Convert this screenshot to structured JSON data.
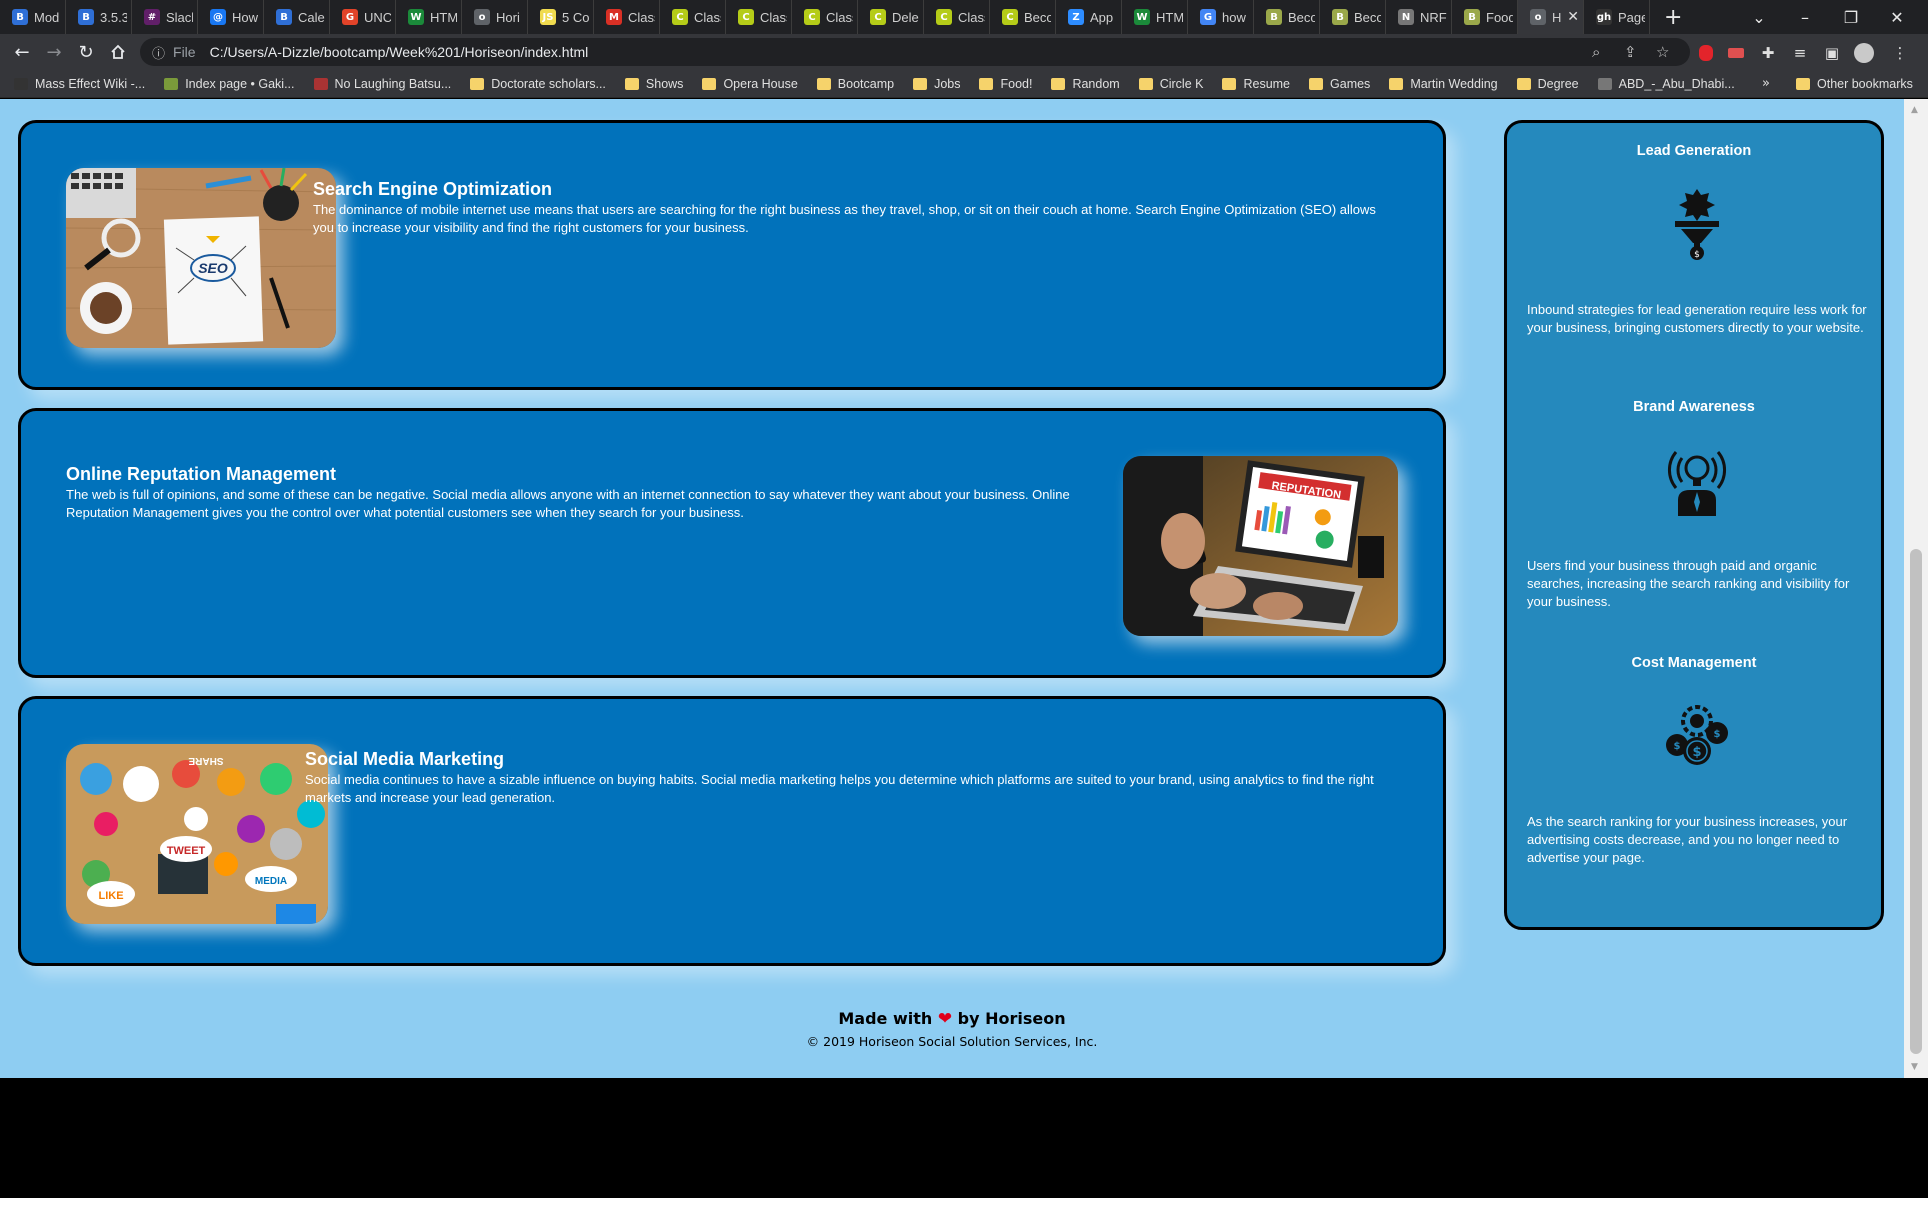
{
  "browser": {
    "tabs": [
      {
        "label": "Mod",
        "color": "#2f6fd6",
        "glyph": "B"
      },
      {
        "label": "3.5.3",
        "color": "#2f6fd6",
        "glyph": "B"
      },
      {
        "label": "Slack",
        "color": "#611f69",
        "glyph": "#"
      },
      {
        "label": "How",
        "color": "#1877f2",
        "glyph": "@"
      },
      {
        "label": "Caler",
        "color": "#2f6fd6",
        "glyph": "B"
      },
      {
        "label": "UNC",
        "color": "#e24329",
        "glyph": "G"
      },
      {
        "label": "HTM",
        "color": "#1b8a3a",
        "glyph": "W"
      },
      {
        "label": "Hori",
        "color": "#5f6368",
        "glyph": "o"
      },
      {
        "label": "5 Co",
        "color": "#f0db4f",
        "glyph": "JS"
      },
      {
        "label": "Class",
        "color": "#d93025",
        "glyph": "M"
      },
      {
        "label": "Class",
        "color": "#b5cc18",
        "glyph": "C"
      },
      {
        "label": "Class",
        "color": "#b5cc18",
        "glyph": "C"
      },
      {
        "label": "Class",
        "color": "#b5cc18",
        "glyph": "C"
      },
      {
        "label": "Dele",
        "color": "#b5cc18",
        "glyph": "C"
      },
      {
        "label": "Class",
        "color": "#b5cc18",
        "glyph": "C"
      },
      {
        "label": "Beco",
        "color": "#b5cc18",
        "glyph": "C"
      },
      {
        "label": "App",
        "color": "#2d8cff",
        "glyph": "Z"
      },
      {
        "label": "HTM",
        "color": "#1b8a3a",
        "glyph": "W"
      },
      {
        "label": "how",
        "color": "#4285f4",
        "glyph": "G"
      },
      {
        "label": "Beco",
        "color": "#9aa84a",
        "glyph": "B"
      },
      {
        "label": "Beco",
        "color": "#9aa84a",
        "glyph": "B"
      },
      {
        "label": "NRF",
        "color": "#777777",
        "glyph": "N"
      },
      {
        "label": "Food",
        "color": "#9aa84a",
        "glyph": "B"
      },
      {
        "label": "H",
        "color": "#5f6368",
        "glyph": "o",
        "active": true
      },
      {
        "label": "Page",
        "color": "#333333",
        "glyph": "gh"
      }
    ],
    "new_tab": "+",
    "window_controls": {
      "dropdown": "⌄",
      "minimize": "–",
      "restore": "❐",
      "close": "✕"
    },
    "tab_close": "✕",
    "address": {
      "info": "ⓘ",
      "scheme": "File",
      "url": "C:/Users/A-Dizzle/bootcamp/Week%201/Horiseon/index.html"
    },
    "bookmarks": [
      {
        "label": "Mass Effect Wiki -...",
        "kind": "site",
        "color": "#333333"
      },
      {
        "label": "Index page • Gaki...",
        "kind": "site",
        "color": "#7a9a3a"
      },
      {
        "label": "No Laughing Batsu...",
        "kind": "site",
        "color": "#aa3333"
      },
      {
        "label": "Doctorate scholars...",
        "kind": "folder"
      },
      {
        "label": "Shows",
        "kind": "folder"
      },
      {
        "label": "Opera House",
        "kind": "folder"
      },
      {
        "label": "Bootcamp",
        "kind": "folder"
      },
      {
        "label": "Jobs",
        "kind": "folder"
      },
      {
        "label": "Food!",
        "kind": "folder"
      },
      {
        "label": "Random",
        "kind": "folder"
      },
      {
        "label": "Circle K",
        "kind": "folder"
      },
      {
        "label": "Resume",
        "kind": "folder"
      },
      {
        "label": "Games",
        "kind": "folder"
      },
      {
        "label": "Martin Wedding",
        "kind": "folder"
      },
      {
        "label": "Degree",
        "kind": "folder"
      },
      {
        "label": "ABD_-_Abu_Dhabi...",
        "kind": "site",
        "color": "#777777"
      }
    ],
    "bookmarks_more": "»",
    "other_bookmarks": "Other bookmarks"
  },
  "page": {
    "sections": [
      {
        "title": "Search Engine Optimization",
        "text": "The dominance of mobile internet use means that users are searching for the right business as they travel, shop, or sit on their couch at home. Search Engine Optimization (SEO) allows you to increase your visibility and find the right customers for your business.",
        "image": "seo-image"
      },
      {
        "title": "Online Reputation Management",
        "text": "The web is full of opinions, and some of these can be negative. Social media allows anyone with an internet connection to say whatever they want about your business. Online Reputation Management gives you the control over what potential customers see when they search for your business.",
        "image": "reputation-image"
      },
      {
        "title": "Social Media Marketing",
        "text": "Social media continues to have a sizable influence on buying habits. Social media marketing helps you determine which platforms are suited to your brand, using analytics to find the right markets and increase your lead generation.",
        "image": "social-media-image"
      }
    ],
    "benefits": [
      {
        "title": "Lead Generation",
        "icon": "lead-generation-icon",
        "text": "Inbound strategies for lead generation require less work for your business, bringing customers directly to your website."
      },
      {
        "title": "Brand Awareness",
        "icon": "brand-awareness-icon",
        "text": "Users find your business through paid and organic searches, increasing the search ranking and visibility for your business."
      },
      {
        "title": "Cost Management",
        "icon": "cost-management-icon",
        "text": "As the search ranking for your business increases, your advertising costs decrease, and you no longer need to advertise your page."
      }
    ],
    "footer": {
      "made_prefix": "Made with",
      "heart": "❤",
      "made_suffix": "by Horiseon",
      "copyright": "© 2019 Horiseon Social Solution Services, Inc."
    },
    "image_text": {
      "seo": "SEO",
      "reputation": "REPUTATION",
      "tweet": "TWEET",
      "like": "LIKE",
      "media": "MEDIA",
      "share": "SHARE"
    }
  },
  "colors": {
    "page_bg": "#8ecdf2",
    "card_bg": "#0172bb",
    "benefits_bg": "#2589bd"
  }
}
